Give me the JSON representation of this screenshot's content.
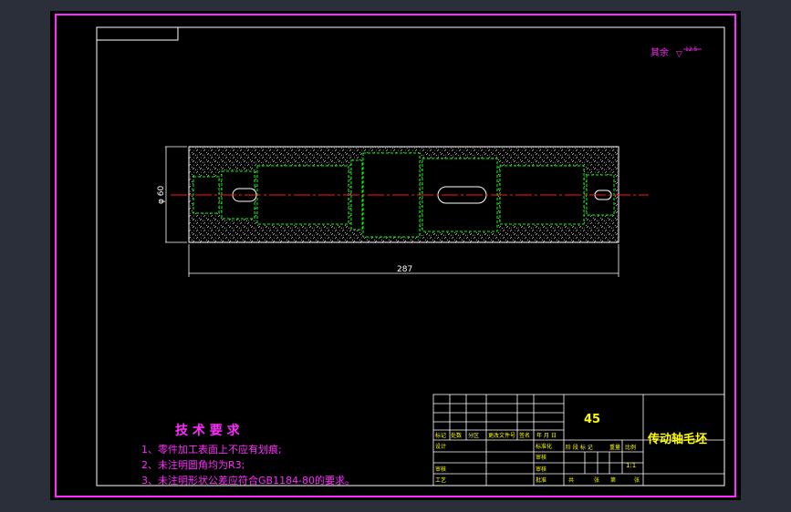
{
  "drawing": {
    "roughness_note": "其余",
    "roughness_symbol": "▽",
    "roughness_value": "12.5",
    "dim_length": "287",
    "dim_diameter": "φ 60"
  },
  "requirements": {
    "heading": "技 术 要 求",
    "items": [
      "1、零件加工表面上不应有划痕;",
      "2、未注明圆角均为R3;",
      "3、未注明形状公差应符合GB1184-80的要求。"
    ]
  },
  "title_block": {
    "material": "45",
    "part_name": "传动轴毛坯",
    "scale": "1:1",
    "row_labels": [
      "标记",
      "处数",
      "分区",
      "更改文件号",
      "签名",
      "年 月 日"
    ],
    "left_labels": [
      "设计",
      "审核",
      "工艺"
    ],
    "mid_labels": [
      "标准化",
      "审核",
      "审核",
      "批准"
    ],
    "stage_labels": [
      "阶 段 标 记",
      "重量",
      "比例"
    ],
    "sheet_labels": [
      "共",
      "张",
      "第",
      "张"
    ]
  },
  "colors": {
    "frame": "#ff2bff",
    "lines": "#ffffff",
    "hidden": "#00ff00",
    "center": "#ff1a1a",
    "text_title": "#ff2bff",
    "text_block": "#ffff00"
  }
}
